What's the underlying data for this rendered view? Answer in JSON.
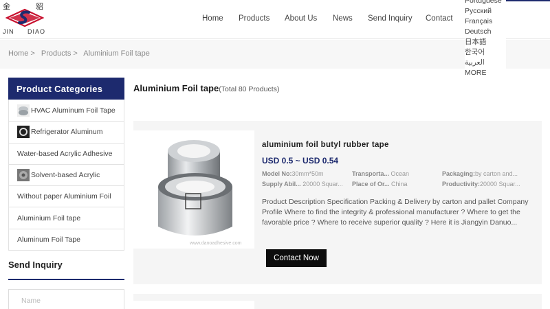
{
  "logo": {
    "cn_left": "金",
    "cn_right": "貂",
    "en_left": "JIN",
    "en_right": "DIAO"
  },
  "nav": {
    "home": "Home",
    "products": "Products",
    "about": "About Us",
    "news": "News",
    "send_inquiry": "Send Inquiry",
    "contact": "Contact"
  },
  "languages": [
    "Portuguese",
    "Русский",
    "Français",
    "Deutsch",
    "日本語",
    "한국어",
    "العربية",
    "MORE"
  ],
  "breadcrumb": {
    "home": "Home",
    "sep": ">",
    "products": "Products",
    "current": "Aluminium Foil tape"
  },
  "sidebar": {
    "heading": "Product Categories",
    "items": [
      {
        "label": "HVAC Aluminum Foil Tape",
        "thumb": true
      },
      {
        "label": "Refrigerator Aluminum",
        "thumb": true
      },
      {
        "label": "Water-based Acrylic Adhesive",
        "thumb": false
      },
      {
        "label": "Solvent-based Acrylic",
        "thumb": true
      },
      {
        "label": "Without paper Aluminium Foil",
        "thumb": false
      },
      {
        "label": "Aluminium Foil tape",
        "thumb": false
      },
      {
        "label": "Aluminum Foil Tape",
        "thumb": false
      }
    ],
    "send_inquiry": "Send Inquiry",
    "name_placeholder": "Name"
  },
  "main": {
    "title": "Aluminium Foil tape",
    "count": "(Total 80 Products)"
  },
  "product": {
    "title": "aluminium foil butyl rubber tape",
    "price": "USD 0.5 ~ USD 0.54",
    "watermark": "www.danoadhesive.com",
    "specs": [
      {
        "key": "Model No:",
        "value": "30mm*50m"
      },
      {
        "key": "Transporta...",
        "value": "Ocean"
      },
      {
        "key": "Packaging:",
        "value": "by carton and..."
      },
      {
        "key": "Supply Abil...",
        "value": "20000 Squar..."
      },
      {
        "key": "Place of Or...",
        "value": "China"
      },
      {
        "key": "Productivity:",
        "value": "20000 Squar..."
      }
    ],
    "description": "Product Description Specification Packing & Delivery by carton and pallet Company Profile Where to find the integrity & professional manufacturer ? Where to get the favorable price ? Where to receive superior quality ? Here it is Jiangyin Danuo...",
    "contact_label": "Contact Now"
  },
  "colors": {
    "brand": "#1d2a6e",
    "button": "#0d0d0d",
    "logo_red": "#c8102e"
  }
}
